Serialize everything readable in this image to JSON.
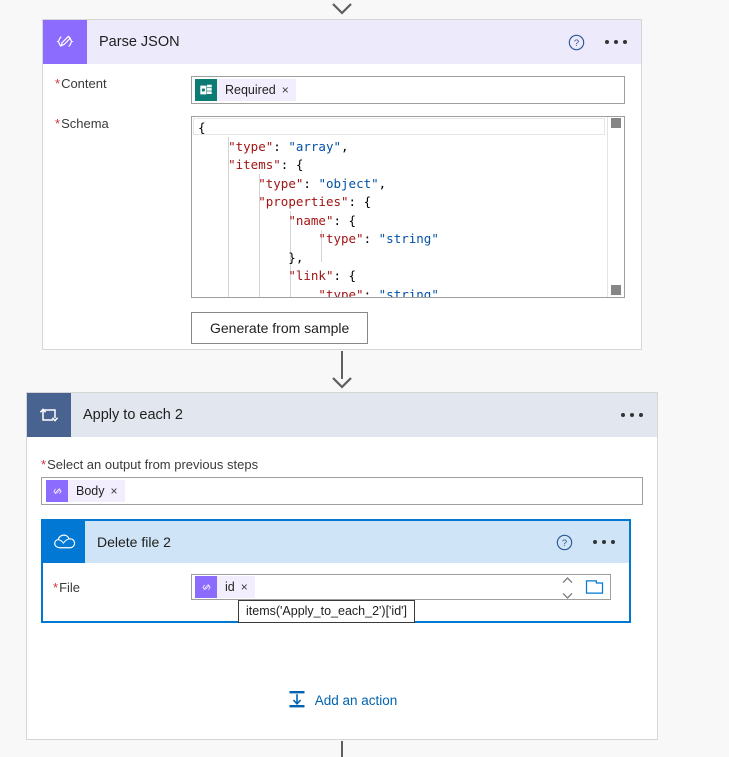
{
  "flow": {
    "connector_icon_top": "arrow-down-icon",
    "connector_icon_middle": "arrow-down-icon"
  },
  "parse_json": {
    "icon": "parse-json-icon",
    "title": "Parse JSON",
    "help_icon": "help-circle-icon",
    "more_icon": "ellipsis-icon",
    "content": {
      "label": "Content",
      "required_marker": "*",
      "token": {
        "icon": "sharepoint-icon",
        "label": "Required",
        "remove_icon": "×"
      }
    },
    "schema": {
      "label": "Schema",
      "required_marker": "*",
      "lines": [
        [
          {
            "t": "{",
            "c": "p"
          }
        ],
        [
          {
            "t": "    ",
            "c": "p"
          },
          {
            "t": "\"type\"",
            "c": "k"
          },
          {
            "t": ": ",
            "c": "p"
          },
          {
            "t": "\"array\"",
            "c": "v"
          },
          {
            "t": ",",
            "c": "p"
          }
        ],
        [
          {
            "t": "    ",
            "c": "p"
          },
          {
            "t": "\"items\"",
            "c": "k"
          },
          {
            "t": ": {",
            "c": "p"
          }
        ],
        [
          {
            "t": "        ",
            "c": "p"
          },
          {
            "t": "\"type\"",
            "c": "k"
          },
          {
            "t": ": ",
            "c": "p"
          },
          {
            "t": "\"object\"",
            "c": "v"
          },
          {
            "t": ",",
            "c": "p"
          }
        ],
        [
          {
            "t": "        ",
            "c": "p"
          },
          {
            "t": "\"properties\"",
            "c": "k"
          },
          {
            "t": ": {",
            "c": "p"
          }
        ],
        [
          {
            "t": "            ",
            "c": "p"
          },
          {
            "t": "\"name\"",
            "c": "k"
          },
          {
            "t": ": {",
            "c": "p"
          }
        ],
        [
          {
            "t": "                ",
            "c": "p"
          },
          {
            "t": "\"type\"",
            "c": "k"
          },
          {
            "t": ": ",
            "c": "p"
          },
          {
            "t": "\"string\"",
            "c": "v"
          }
        ],
        [
          {
            "t": "            },",
            "c": "p"
          }
        ],
        [
          {
            "t": "            ",
            "c": "p"
          },
          {
            "t": "\"link\"",
            "c": "k"
          },
          {
            "t": ": {",
            "c": "p"
          }
        ],
        [
          {
            "t": "                ",
            "c": "p"
          },
          {
            "t": "\"type\"",
            "c": "k"
          },
          {
            "t": ": ",
            "c": "p"
          },
          {
            "t": "\"string\"",
            "c": "v"
          }
        ]
      ],
      "scrollbar": "vertical-scrollbar"
    },
    "generate_button": "Generate from sample"
  },
  "apply_to_each": {
    "icon": "foreach-loop-icon",
    "title": "Apply to each 2",
    "more_icon": "ellipsis-icon",
    "select_output": {
      "label": "Select an output from previous steps",
      "required_marker": "*",
      "token": {
        "icon": "parse-json-icon",
        "label": "Body",
        "remove_icon": "×"
      }
    },
    "add_action": {
      "icon": "add-action-icon",
      "label": "Add an action"
    }
  },
  "delete_file": {
    "icon": "onedrive-icon",
    "title": "Delete file 2",
    "help_icon": "help-circle-icon",
    "more_icon": "ellipsis-icon",
    "file": {
      "label": "File",
      "required_marker": "*",
      "token": {
        "icon": "parse-json-icon",
        "label": "id",
        "remove_icon": "×"
      },
      "spinner_icon": "spinner-updown-icon",
      "folder_icon": "folder-picker-icon"
    },
    "tooltip": "items('Apply_to_each_2')['id']"
  },
  "colors": {
    "parse_json_accent": "#8c6cff",
    "parse_json_header": "#eceafb",
    "foreach_accent": "#486390",
    "foreach_header": "#e1e6ef",
    "onedrive_accent": "#0078d4",
    "onedrive_header": "#cfe4f7",
    "selection_border": "#0078d4",
    "link": "#0063b1",
    "required_star": "#d13438",
    "json_key": "#a31515",
    "json_value": "#0451a5"
  }
}
